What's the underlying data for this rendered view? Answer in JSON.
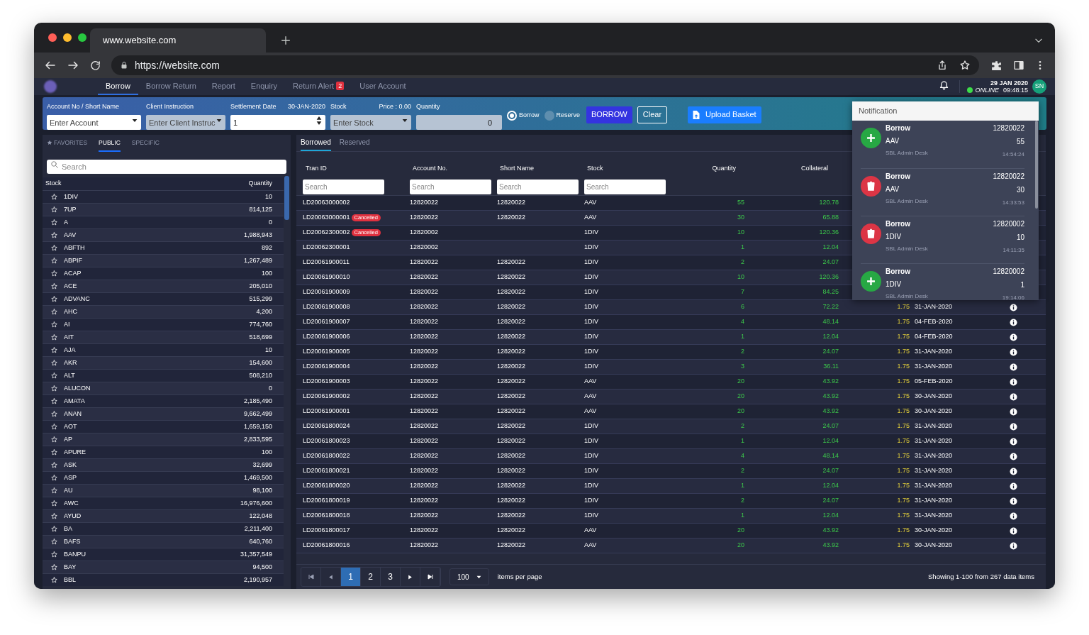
{
  "browser": {
    "tab_title": "www.website.com",
    "url": "https://website.com"
  },
  "nav": {
    "tabs": [
      {
        "label": "Borrow",
        "selected": true
      },
      {
        "label": "Borrow Return",
        "selected": false
      },
      {
        "label": "Report",
        "selected": false
      },
      {
        "label": "Enquiry",
        "selected": false
      },
      {
        "label": "Return Alert",
        "selected": false,
        "badge": "2"
      },
      {
        "label": "User Account",
        "selected": false
      }
    ]
  },
  "header": {
    "date": "29 JAN 2020",
    "online": true,
    "status": "ONLINE",
    "time": "09:48:15",
    "avatar": "SN"
  },
  "order_form": {
    "fields": [
      {
        "kind": "dropdown",
        "label": "Account No / Short Name",
        "placeholder": "Enter Account",
        "disabled": false
      },
      {
        "kind": "dropdown",
        "label": "Client Instruction",
        "placeholder": "Enter Client Instruc",
        "disabled": true
      },
      {
        "kind": "spinner",
        "label": "Settlement Date",
        "aside": "30-JAN-2020",
        "value": "1",
        "disabled": false
      },
      {
        "kind": "dropdown",
        "label": "Stock",
        "aside": "Price : 0.00",
        "placeholder": "Enter Stock",
        "disabled": true
      },
      {
        "kind": "number",
        "label": "Quantity",
        "value": "0",
        "disabled": true
      }
    ],
    "radios": [
      {
        "label": "Borrow",
        "selected": true
      },
      {
        "label": "Reserve",
        "selected": false
      }
    ],
    "buttons": [
      {
        "label": "BORROW",
        "kind": "primary"
      },
      {
        "label": "Clear",
        "kind": "outline"
      },
      {
        "label": "Upload Basket",
        "kind": "upload"
      }
    ]
  },
  "stock_panel": {
    "tabs": [
      {
        "label": "FAVORITES",
        "kind": "favorites",
        "selected": false
      },
      {
        "label": "PUBLIC",
        "kind": "list",
        "selected": true
      },
      {
        "label": "SPECIFIC",
        "kind": "list",
        "selected": false
      }
    ],
    "search": {
      "placeholder": "Search"
    },
    "columns": [
      "Stock",
      "Quantity"
    ],
    "rows": [
      {
        "stock": "1DIV",
        "quantity": "10"
      },
      {
        "stock": "7UP",
        "quantity": "814,125"
      },
      {
        "stock": "A",
        "quantity": "0"
      },
      {
        "stock": "AAV",
        "quantity": "1,988,943"
      },
      {
        "stock": "ABFTH",
        "quantity": "892"
      },
      {
        "stock": "ABPIF",
        "quantity": "1,267,489"
      },
      {
        "stock": "ACAP",
        "quantity": "100"
      },
      {
        "stock": "ACE",
        "quantity": "205,010"
      },
      {
        "stock": "ADVANC",
        "quantity": "515,299"
      },
      {
        "stock": "AHC",
        "quantity": "4,200"
      },
      {
        "stock": "AI",
        "quantity": "774,760"
      },
      {
        "stock": "AIT",
        "quantity": "518,699"
      },
      {
        "stock": "AJA",
        "quantity": "10"
      },
      {
        "stock": "AKR",
        "quantity": "154,600"
      },
      {
        "stock": "ALT",
        "quantity": "508,210"
      },
      {
        "stock": "ALUCON",
        "quantity": "0"
      },
      {
        "stock": "AMATA",
        "quantity": "2,185,490"
      },
      {
        "stock": "ANAN",
        "quantity": "9,662,499"
      },
      {
        "stock": "AOT",
        "quantity": "1,659,150"
      },
      {
        "stock": "AP",
        "quantity": "2,833,595"
      },
      {
        "stock": "APURE",
        "quantity": "100"
      },
      {
        "stock": "ASK",
        "quantity": "32,699"
      },
      {
        "stock": "ASP",
        "quantity": "1,469,500"
      },
      {
        "stock": "AU",
        "quantity": "98,100"
      },
      {
        "stock": "AWC",
        "quantity": "16,976,600"
      },
      {
        "stock": "AYUD",
        "quantity": "122,048"
      },
      {
        "stock": "BA",
        "quantity": "2,211,400"
      },
      {
        "stock": "BAFS",
        "quantity": "640,760"
      },
      {
        "stock": "BANPU",
        "quantity": "31,357,549"
      },
      {
        "stock": "BAY",
        "quantity": "94,500"
      },
      {
        "stock": "BBL",
        "quantity": "2,190,957"
      }
    ]
  },
  "transactions": {
    "tabs": [
      {
        "label": "Borrowed",
        "selected": true
      },
      {
        "label": "Reserved",
        "selected": false
      }
    ],
    "columns": [
      "Tran ID",
      "Account No.",
      "Short Name",
      "Stock",
      "Quantity",
      "Collateral"
    ],
    "filters": [
      {
        "placeholder": "Search"
      },
      {
        "placeholder": "Search"
      },
      {
        "placeholder": "Search"
      },
      {
        "placeholder": "Search"
      }
    ],
    "rows": [
      {
        "tran_id": "LD20063000002",
        "account": "12820022",
        "short_name": "12820022",
        "stock": "AAV",
        "quantity": "55",
        "collateral": "120.78"
      },
      {
        "tran_id": "LD20063000001",
        "badge": "Cancelled",
        "account": "12820022",
        "short_name": "12820022",
        "stock": "AAV",
        "quantity": "30",
        "collateral": "65.88"
      },
      {
        "tran_id": "LD20062300002",
        "badge": "Cancelled",
        "account": "12820002",
        "stock": "1DIV",
        "quantity": "10",
        "collateral": "120.36"
      },
      {
        "tran_id": "LD20062300001",
        "account": "12820002",
        "stock": "1DIV",
        "quantity": "1",
        "collateral": "12.04"
      },
      {
        "tran_id": "LD20061900011",
        "account": "12820022",
        "short_name": "12820022",
        "stock": "1DIV",
        "quantity": "2",
        "collateral": "24.07"
      },
      {
        "tran_id": "LD20061900010",
        "account": "12820022",
        "short_name": "12820022",
        "stock": "1DIV",
        "quantity": "10",
        "collateral": "120.36"
      },
      {
        "tran_id": "LD20061900009",
        "account": "12820022",
        "short_name": "12820022",
        "stock": "1DIV",
        "quantity": "7",
        "collateral": "84.25"
      },
      {
        "tran_id": "LD20061900008",
        "account": "12820022",
        "short_name": "12820022",
        "stock": "1DIV",
        "quantity": "6",
        "collateral": "72.22",
        "rate": "1.75",
        "date": "31-JAN-2020"
      },
      {
        "tran_id": "LD20061900007",
        "account": "12820022",
        "short_name": "12820022",
        "stock": "1DIV",
        "quantity": "4",
        "collateral": "48.14",
        "rate": "1.75",
        "date": "04-FEB-2020"
      },
      {
        "tran_id": "LD20061900006",
        "account": "12820022",
        "short_name": "12820022",
        "stock": "1DIV",
        "quantity": "1",
        "collateral": "12.04",
        "rate": "1.75",
        "date": "04-FEB-2020"
      },
      {
        "tran_id": "LD20061900005",
        "account": "12820022",
        "short_name": "12820022",
        "stock": "1DIV",
        "quantity": "2",
        "collateral": "24.07",
        "rate": "1.75",
        "date": "31-JAN-2020"
      },
      {
        "tran_id": "LD20061900004",
        "account": "12820022",
        "short_name": "12820022",
        "stock": "1DIV",
        "quantity": "3",
        "collateral": "36.11",
        "rate": "1.75",
        "date": "31-JAN-2020"
      },
      {
        "tran_id": "LD20061900003",
        "account": "12820022",
        "short_name": "12820022",
        "stock": "AAV",
        "quantity": "20",
        "collateral": "43.92",
        "rate": "1.75",
        "date": "05-FEB-2020"
      },
      {
        "tran_id": "LD20061900002",
        "account": "12820022",
        "short_name": "12820022",
        "stock": "AAV",
        "quantity": "20",
        "collateral": "43.92",
        "rate": "1.75",
        "date": "30-JAN-2020"
      },
      {
        "tran_id": "LD20061900001",
        "account": "12820022",
        "short_name": "12820022",
        "stock": "AAV",
        "quantity": "20",
        "collateral": "43.92",
        "rate": "1.75",
        "date": "30-JAN-2020"
      },
      {
        "tran_id": "LD20061800024",
        "account": "12820022",
        "short_name": "12820022",
        "stock": "1DIV",
        "quantity": "2",
        "collateral": "24.07",
        "rate": "1.75",
        "date": "31-JAN-2020"
      },
      {
        "tran_id": "LD20061800023",
        "account": "12820022",
        "short_name": "12820022",
        "stock": "1DIV",
        "quantity": "1",
        "collateral": "12.04",
        "rate": "1.75",
        "date": "31-JAN-2020"
      },
      {
        "tran_id": "LD20061800022",
        "account": "12820022",
        "short_name": "12820022",
        "stock": "1DIV",
        "quantity": "4",
        "collateral": "48.14",
        "rate": "1.75",
        "date": "31-JAN-2020"
      },
      {
        "tran_id": "LD20061800021",
        "account": "12820022",
        "short_name": "12820022",
        "stock": "1DIV",
        "quantity": "2",
        "collateral": "24.07",
        "rate": "1.75",
        "date": "31-JAN-2020"
      },
      {
        "tran_id": "LD20061800020",
        "account": "12820022",
        "short_name": "12820022",
        "stock": "1DIV",
        "quantity": "1",
        "collateral": "12.04",
        "rate": "1.75",
        "date": "31-JAN-2020"
      },
      {
        "tran_id": "LD20061800019",
        "account": "12820022",
        "short_name": "12820022",
        "stock": "1DIV",
        "quantity": "2",
        "collateral": "24.07",
        "rate": "1.75",
        "date": "31-JAN-2020"
      },
      {
        "tran_id": "LD20061800018",
        "account": "12820022",
        "short_name": "12820022",
        "stock": "1DIV",
        "quantity": "1",
        "collateral": "12.04",
        "rate": "1.75",
        "date": "31-JAN-2020"
      },
      {
        "tran_id": "LD20061800017",
        "account": "12820022",
        "short_name": "12820022",
        "stock": "AAV",
        "quantity": "20",
        "collateral": "43.92",
        "rate": "1.75",
        "date": "30-JAN-2020"
      },
      {
        "tran_id": "LD20061800016",
        "account": "12820022",
        "short_name": "12820022",
        "stock": "AAV",
        "quantity": "20",
        "collateral": "43.92",
        "rate": "1.75",
        "date": "30-JAN-2020"
      }
    ],
    "pagination": {
      "pages": [
        {
          "label": "1",
          "selected": true
        },
        {
          "label": "2",
          "selected": false
        },
        {
          "label": "3",
          "selected": false
        }
      ],
      "page_size": "100",
      "per_page_label": "items per page",
      "summary": "Showing 1-100 from 267 data items"
    }
  },
  "notifications": {
    "title": "Notification",
    "items": [
      {
        "kind": "add",
        "action": "Borrow",
        "account": "12820022",
        "stock": "AAV",
        "quantity": "55",
        "source": "SBL Admin Desk",
        "time": "14:54:24"
      },
      {
        "kind": "delete",
        "action": "Borrow",
        "account": "12820022",
        "stock": "AAV",
        "quantity": "30",
        "source": "SBL Admin Desk",
        "time": "14:33:53"
      },
      {
        "kind": "delete",
        "action": "Borrow",
        "account": "12820002",
        "stock": "1DIV",
        "quantity": "10",
        "source": "SBL Admin Desk",
        "time": "14:11:35"
      },
      {
        "kind": "add",
        "action": "Borrow",
        "account": "12820002",
        "stock": "1DIV",
        "quantity": "1",
        "source": "SBL Admin Desk",
        "time": "19:14:06"
      }
    ]
  }
}
